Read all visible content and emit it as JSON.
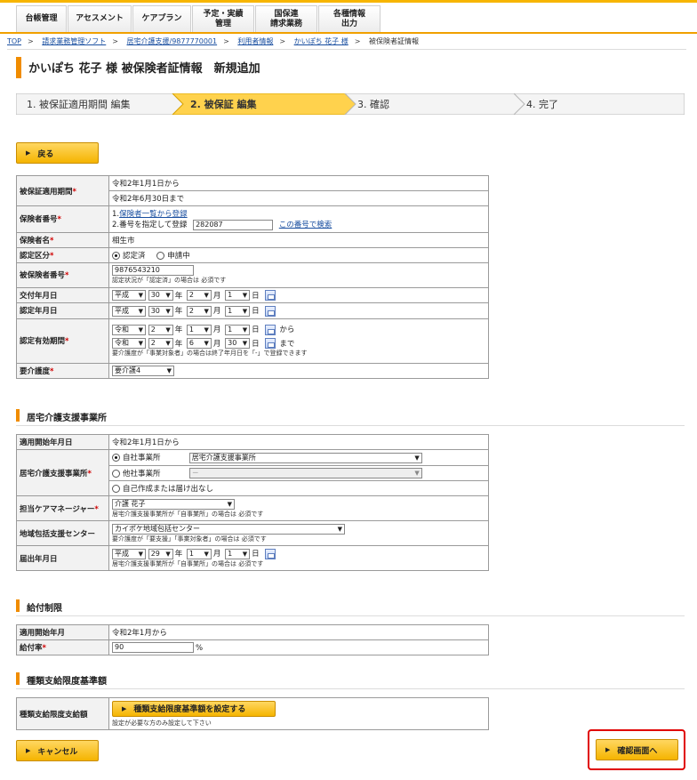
{
  "nav": {
    "tabs": [
      "台帳管理",
      "アセスメント",
      "ケアプラン",
      "予定・実績\n管理",
      "国保連\n請求業務",
      "各種情報\n出力"
    ]
  },
  "breadcrumb": {
    "top": "TOP",
    "items": [
      "請求業務管理ソフト",
      "居宅介護支援/9877770001",
      "利用者情報",
      "かいぽち 花子 様"
    ],
    "current": "被保険者証情報"
  },
  "page_title": "かいぽち 花子 様 被保険者証情報　新規追加",
  "steps": [
    "1. 被保証適用期間 編集",
    "2. 被保証 編集",
    "3. 確認",
    "4. 完了"
  ],
  "buttons": {
    "back": "戻る",
    "cancel": "キャンセル",
    "confirm": "確認画面へ",
    "set_limit": "種類支給限度基準額を設定する"
  },
  "insurance": {
    "period_label": "被保証適用期間",
    "period_from": "令和2年1月1日から",
    "period_to": "令和2年6月30日まで",
    "insurer_no_label": "保険者番号",
    "insurer_opt1_prefix": "1.",
    "insurer_opt1_link": "保険者一覧から登録",
    "insurer_opt2": "2.番号を指定して登録",
    "insurer_no_value": "282087",
    "search_link": "この番号で検索",
    "insurer_name_label": "保険者名",
    "insurer_name": "相生市",
    "cert_class_label": "認定区分",
    "cert_class_opt1": "認定済",
    "cert_class_opt2": "申請中",
    "insured_no_label": "被保険者番号",
    "insured_no": "9876543210",
    "insured_no_note": "認定状況が「認定済」の場合は 必須です",
    "issue_date_label": "交付年月日",
    "cert_date_label": "認定年月日",
    "valid_label": "認定有効期間",
    "valid_from_suffix": "から",
    "valid_to_suffix": "まで",
    "valid_note": "要介護度が「事業対象者」の場合は終了年月日を「-」で登録できます",
    "care_level_label": "要介護度",
    "care_level": "要介護4",
    "issue_date": {
      "era": "平成",
      "year": "30",
      "month": "2",
      "day": "1"
    },
    "cert_date": {
      "era": "平成",
      "year": "30",
      "month": "2",
      "day": "1"
    },
    "valid_from": {
      "era": "令和",
      "year": "2",
      "month": "1",
      "day": "1"
    },
    "valid_to": {
      "era": "令和",
      "year": "2",
      "month": "6",
      "day": "30"
    }
  },
  "units": {
    "year": "年",
    "month": "月",
    "day": "日"
  },
  "care_office": {
    "section_title": "居宅介護支援事業所",
    "start_label": "適用開始年月日",
    "start_value": "令和2年1月1日から",
    "office_label": "居宅介護支援事業所",
    "own_office": "自社事業所",
    "own_office_value": "居宅介護支援事業所",
    "other_office": "他社事業所",
    "other_office_value": "－",
    "self_made": "自己作成または届け出なし",
    "manager_label": "担当ケアマネージャー",
    "manager_value": "介護 花子",
    "manager_note": "居宅介護支援事業所が「自事業所」の場合は 必須です",
    "center_label": "地域包括支援センター",
    "center_value": "カイポケ地域包括センター",
    "center_note": "要介護度が「要支援」「事業対象者」の場合は 必須です",
    "notify_label": "届出年月日",
    "notify_date": {
      "era": "平成",
      "year": "29",
      "month": "1",
      "day": "1"
    },
    "notify_note": "居宅介護支援事業所が「自事業所」の場合は 必須です"
  },
  "benefit": {
    "section_title": "給付制限",
    "start_label": "適用開始年月",
    "start_value": "令和2年1月から",
    "rate_label": "給付率",
    "rate_value": "90",
    "rate_unit": "%"
  },
  "limit": {
    "section_title": "種類支給限度基準額",
    "label": "種類支給限度支給額",
    "note": "設定が必要な方のみ設定して下さい"
  },
  "colors": {
    "accent": "#f08c00",
    "button": "#f5b400",
    "highlight": "#e00000"
  }
}
